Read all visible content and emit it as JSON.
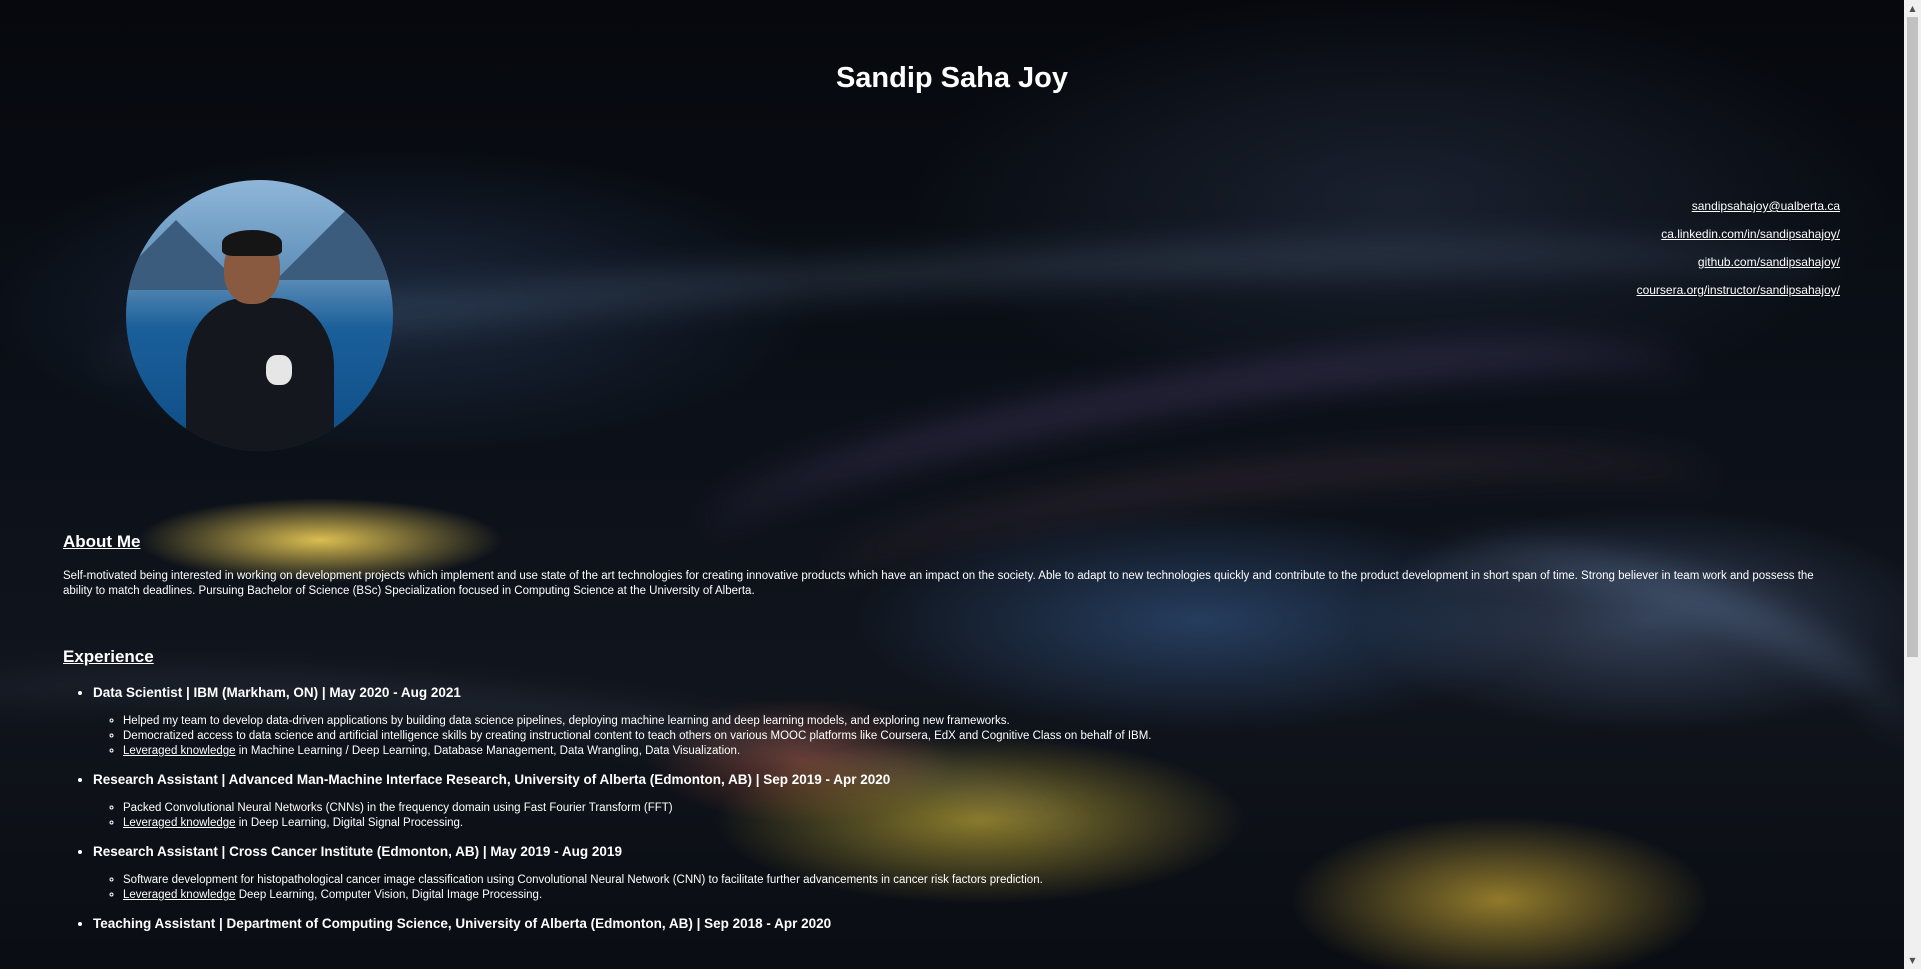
{
  "header": {
    "name": "Sandip Saha Joy"
  },
  "profile": {
    "avatar_alt": ""
  },
  "contact": {
    "email": "sandipsahajoy@ualberta.ca",
    "linkedin": "ca.linkedin.com/in/sandipsahajoy/",
    "github": "github.com/sandipsahajoy/",
    "coursera": "coursera.org/instructor/sandipsahajoy/"
  },
  "about": {
    "heading": "About Me",
    "text": "Self-motivated being interested in working on development projects which implement and use state of the art technologies for creating innovative products which have an impact on the society. Able to adapt to new technologies quickly and contribute to the product development in short span of time. Strong believer in team work and possess the ability to match deadlines. Pursuing Bachelor of Science (BSc) Specialization focused in Computing Science at the University of Alberta."
  },
  "experience": {
    "heading": "Experience",
    "items": [
      {
        "title": "Data Scientist | IBM (Markham, ON) | May 2020 - Aug 2021",
        "bullets": [
          {
            "link": "",
            "text": "Helped my team to develop data-driven applications by building data science pipelines, deploying machine learning and deep learning models, and exploring new frameworks."
          },
          {
            "link": "",
            "text": "Democratized access to data science and artificial intelligence skills by creating instructional content to teach others on various MOOC platforms like Coursera, EdX and Cognitive Class on behalf of IBM."
          },
          {
            "link": "Leveraged knowledge",
            "text": " in Machine Learning / Deep Learning, Database Management, Data Wrangling, Data Visualization."
          }
        ]
      },
      {
        "title": "Research Assistant | Advanced Man-Machine Interface Research, University of Alberta (Edmonton, AB) | Sep 2019 - Apr 2020",
        "bullets": [
          {
            "link": "",
            "text": "Packed Convolutional Neural Networks (CNNs) in the frequency domain using Fast Fourier Transform (FFT)"
          },
          {
            "link": "Leveraged knowledge",
            "text": " in Deep Learning, Digital Signal Processing."
          }
        ]
      },
      {
        "title": "Research Assistant | Cross Cancer Institute (Edmonton, AB) | May 2019 - Aug 2019",
        "bullets": [
          {
            "link": "",
            "text": "Software development for histopathological cancer image classification using Convolutional Neural Network (CNN) to facilitate further advancements in cancer risk factors prediction."
          },
          {
            "link": "Leveraged knowledge",
            "text": " Deep Learning, Computer Vision, Digital Image Processing."
          }
        ]
      },
      {
        "title": "Teaching Assistant | Department of Computing Science, University of Alberta (Edmonton, AB) | Sep 2018 - Apr 2020",
        "bullets": []
      }
    ]
  },
  "scrollbar": {
    "up_icon": "▲",
    "down_icon": "▼"
  }
}
